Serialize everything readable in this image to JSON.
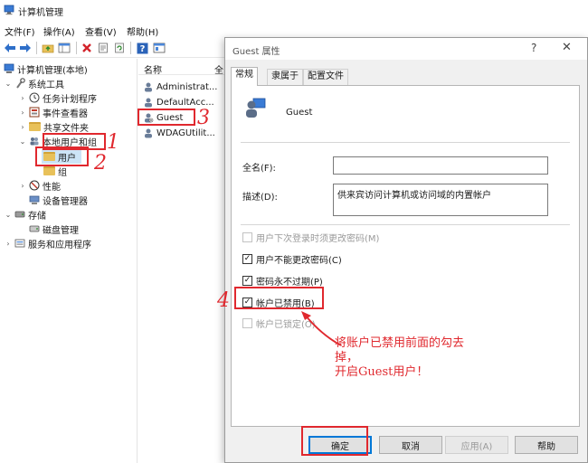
{
  "window": {
    "title": "计算机管理",
    "menu": [
      "文件(F)",
      "操作(A)",
      "查看(V)",
      "帮助(H)"
    ]
  },
  "toolbar": {
    "icons": [
      "back-arrow",
      "forward-arrow",
      "up-folder",
      "show-tree",
      "delete-x",
      "properties",
      "refresh",
      "help",
      "view"
    ]
  },
  "tree": {
    "root": "计算机管理(本地)",
    "system_tools": "系统工具",
    "task_scheduler": "任务计划程序",
    "event_viewer": "事件查看器",
    "shared_folders": "共享文件夹",
    "local_users_groups": "本地用户和组",
    "users": "用户",
    "groups": "组",
    "performance": "性能",
    "device_manager": "设备管理器",
    "storage": "存储",
    "disk_management": "磁盘管理",
    "services_apps": "服务和应用程序"
  },
  "list": {
    "col_name": "名称",
    "col_fullname": "全",
    "rows": [
      "Administrat...",
      "DefaultAcc...",
      "Guest",
      "WDAGUtilit..."
    ]
  },
  "dialog": {
    "title": "Guest 属性",
    "help_glyph": "?",
    "close_glyph": "✕",
    "tabs": [
      "常规",
      "隶属于",
      "配置文件"
    ],
    "username": "Guest",
    "fullname_label": "全名(F):",
    "fullname_value": "",
    "desc_label": "描述(D):",
    "desc_value": "供来宾访问计算机或访问域的内置帐户",
    "options": {
      "must_change": "用户下次登录时须更改密码(M)",
      "cannot_change": "用户不能更改密码(C)",
      "never_expires": "密码永不过期(P)",
      "disabled": "帐户已禁用(B)",
      "locked": "帐户已锁定(O)"
    },
    "buttons": {
      "ok": "确定",
      "cancel": "取消",
      "apply": "应用(A)",
      "help": "帮助"
    }
  },
  "annotations": {
    "n1": "1",
    "n2": "2",
    "n3": "3",
    "n4": "4",
    "note": "将账户已禁用前面的勾去\n掉，\n开启Guest用户！",
    "color": "#e0282e"
  }
}
